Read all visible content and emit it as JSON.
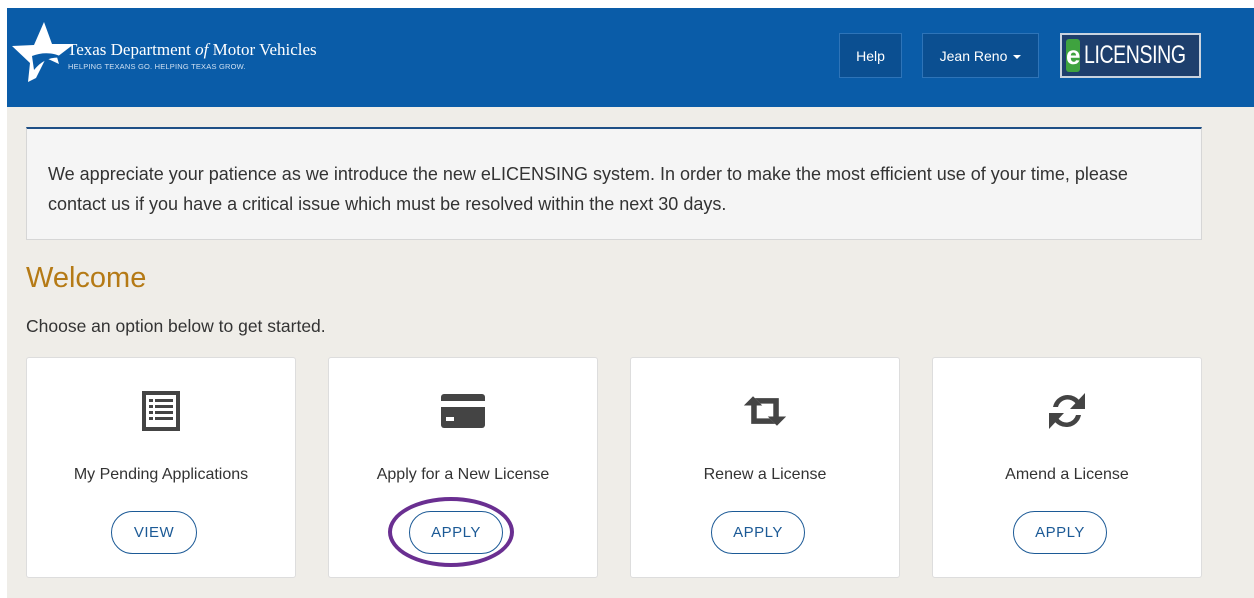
{
  "header": {
    "org_prefix": "Texas Department ",
    "org_of": "of",
    "org_suffix": " Motor Vehicles",
    "tagline": "HELPING TEXANS GO. HELPING TEXAS GROW.",
    "help_label": "Help",
    "user_label": "Jean Reno",
    "badge_e": "e",
    "badge_text": "LICENSING"
  },
  "notice": {
    "text": "We appreciate your patience as we introduce the new eLICENSING system. In order to make the most efficient use of your time, please contact us if you have a critical issue which must be resolved within the next 30 days."
  },
  "main": {
    "title": "Welcome",
    "subtitle": "Choose an option below to get started.",
    "cards": [
      {
        "label": "My Pending Applications",
        "action": "VIEW",
        "icon": "list-icon"
      },
      {
        "label": "Apply for a New License",
        "action": "APPLY",
        "icon": "credit-card-icon"
      },
      {
        "label": "Renew a License",
        "action": "APPLY",
        "icon": "retweet-icon"
      },
      {
        "label": "Amend a License",
        "action": "APPLY",
        "icon": "refresh-icon"
      }
    ]
  },
  "colors": {
    "header_bg": "#0a5ca8",
    "welcome": "#b57a15",
    "button_outline": "#1c5a96",
    "highlight": "#6a2f91"
  }
}
